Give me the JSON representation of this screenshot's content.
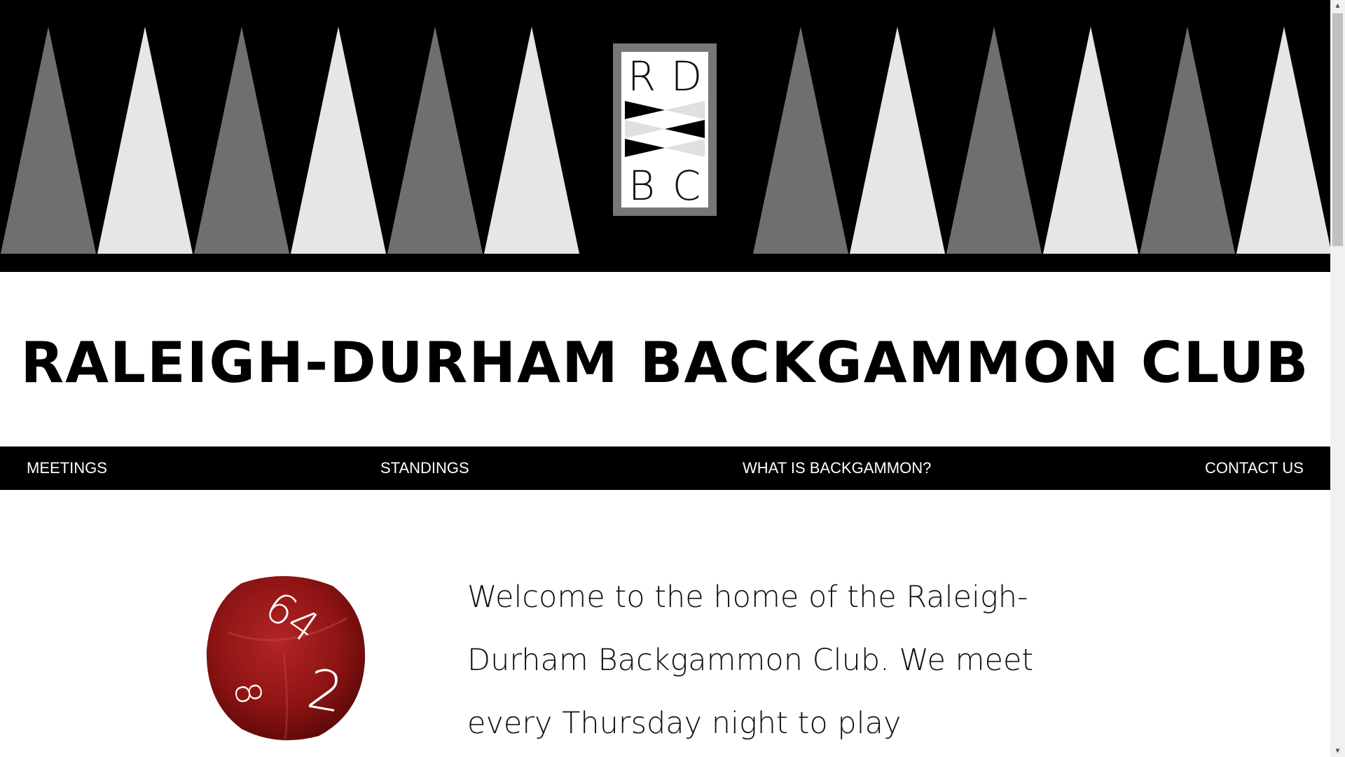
{
  "colors": {
    "banner_bg": "#000000",
    "point_dark": "#6f6f6f",
    "point_light": "#e6e6e6",
    "nav_bg": "#000000",
    "nav_text": "#ffffff",
    "die_red": "#8e1414"
  },
  "logo": {
    "letters": [
      "R",
      "D",
      "B",
      "C"
    ]
  },
  "site_title": "RALEIGH-DURHAM BACKGAMMON CLUB",
  "nav": {
    "items": [
      {
        "label": "MEETINGS"
      },
      {
        "label": "STANDINGS"
      },
      {
        "label": "WHAT IS BACKGAMMON?"
      },
      {
        "label": "CONTACT US"
      }
    ]
  },
  "doubling_cube": {
    "faces": [
      "64",
      "8",
      "2"
    ]
  },
  "welcome_text": "Welcome to the home of the Raleigh-Durham Backgammon Club. We meet every Thursday night to play",
  "scrollbar": {
    "up_icon": "chevron-up-icon",
    "down_icon": "chevron-down-icon"
  }
}
